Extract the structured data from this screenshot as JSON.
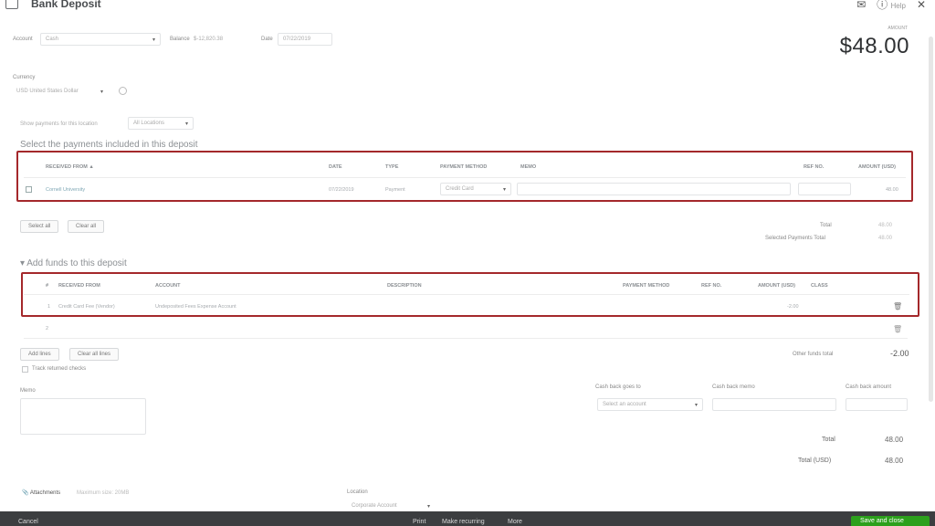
{
  "header": {
    "title": "Bank Deposit",
    "help_label": "Help"
  },
  "top_fields": {
    "account_label": "Account",
    "account_value": "Cash",
    "balance_label": "Balance",
    "balance_value": "$-12,820.38",
    "date_label": "Date",
    "date_value": "07/22/2019"
  },
  "amount": {
    "label": "AMOUNT",
    "value": "$48.00"
  },
  "currency": {
    "label": "Currency",
    "value": "USD United States Dollar"
  },
  "filter": {
    "label": "Show payments for this location",
    "value": "All Locations"
  },
  "payments_section": {
    "title": "Select the payments included in this deposit",
    "columns": [
      "RECEIVED FROM ▲",
      "DATE",
      "TYPE",
      "PAYMENT METHOD",
      "MEMO",
      "REF NO.",
      "AMOUNT (USD)"
    ],
    "row": {
      "received_from": "Cornell University",
      "date": "07/22/2019",
      "type": "Payment",
      "payment_method": "Credit Card",
      "amount": "48.00"
    },
    "select_all": "Select all",
    "clear_all": "Clear all",
    "total_label": "Total",
    "total_value": "48.00",
    "selected_total_label": "Selected Payments Total",
    "selected_total_value": "48.00"
  },
  "funds_section": {
    "title": "Add funds to this deposit",
    "columns": [
      "#",
      "RECEIVED FROM",
      "ACCOUNT",
      "DESCRIPTION",
      "PAYMENT METHOD",
      "REF NO.",
      "AMOUNT (USD)",
      "CLASS"
    ],
    "row": {
      "num": "1",
      "received_from": "Credit Card Fee (Vendor)",
      "account": "Undeposited Fees Expense Account",
      "amount": "-2.00"
    },
    "row2_num": "2",
    "add_lines": "Add lines",
    "clear_all_lines": "Clear all lines",
    "other_total_label": "Other funds total",
    "other_total_value": "-2.00",
    "track_returns_label": "Track returned checks"
  },
  "memo": {
    "label": "Memo"
  },
  "cashback": {
    "goes_to_label": "Cash back goes to",
    "goes_to_placeholder": "Select an account",
    "memo_label": "Cash back memo",
    "amount_label": "Cash back amount"
  },
  "totals": {
    "total_label": "Total",
    "total_value": "48.00",
    "total_usd_label": "Total (USD)",
    "total_usd_value": "48.00"
  },
  "attachments": {
    "label": "Attachments",
    "max_size": "Maximum size: 20MB"
  },
  "location": {
    "label": "Location",
    "value": "Corporate Account"
  },
  "footer": {
    "cancel": "Cancel",
    "print": "Print",
    "make_recurring": "Make recurring",
    "more": "More",
    "save": "Save and close"
  },
  "colors": {
    "accent_red": "#a4282b",
    "save_green": "#2ca01c",
    "footer_bg": "#3c3e40"
  }
}
